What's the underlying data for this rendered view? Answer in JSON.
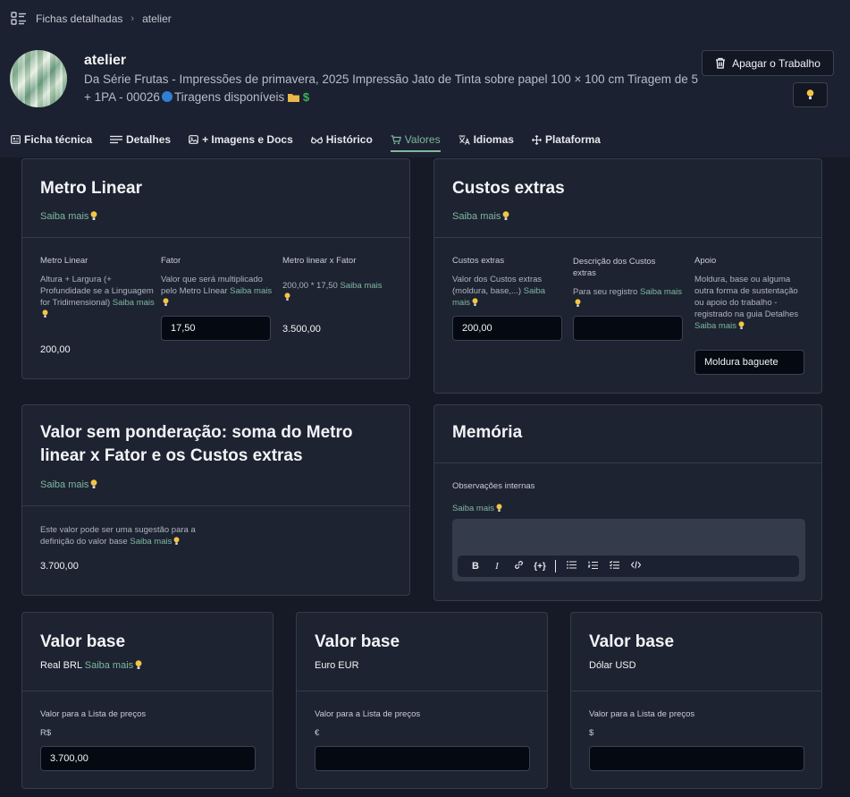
{
  "breadcrumb": {
    "items": [
      "Fichas detalhadas",
      "atelier"
    ]
  },
  "header": {
    "title": "atelier",
    "subtitle": "Da Série Frutas - Impressões de primavera, 2025 Impressão Jato de Tinta sobre papel 100 × 100 cm Tiragem de 5 + 1PA - 00026",
    "availability": "Tiragens disponíveis",
    "delete_label": "Apagar o Trabalho"
  },
  "tabs": [
    {
      "label": "Ficha técnica",
      "icon": "id-card-icon"
    },
    {
      "label": "Detalhes",
      "icon": "list-icon"
    },
    {
      "label": "+ Imagens e Docs",
      "icon": "image-icon"
    },
    {
      "label": "Histórico",
      "icon": "glasses-icon"
    },
    {
      "label": "Valores",
      "icon": "cart-icon",
      "active": true
    },
    {
      "label": "Idiomas",
      "icon": "globe-icon"
    },
    {
      "label": "Plataforma",
      "icon": "move-icon"
    }
  ],
  "saiba": "Saiba mais",
  "metro": {
    "title": "Metro Linear",
    "col1_label": "Metro Linear",
    "col1_desc": "Altura + Largura (+ Profundidade se a Linguagem for Tridimensional)",
    "col1_value": "200,00",
    "col2_label": "Fator",
    "col2_desc": "Valor que será multiplicado pelo Metro LInear",
    "col2_value": "17,50",
    "col3_label": "Metro linear x Fator",
    "col3_desc": "200,00 * 17,50",
    "col3_value": "3.500,00"
  },
  "custos": {
    "title": "Custos extras",
    "col1_label": "Custos extras",
    "col1_desc": "Valor dos Custos extras (moldura, base,...)",
    "col1_value": "200,00",
    "col2_label": "Descrição dos Custos extras",
    "col2_desc": "Para seu registro",
    "col2_value": "",
    "col3_label": "Apoio",
    "col3_desc": "Moldura, base ou alguma outra forma de sustentação ou apoio do trabalho - registrado na guia Detalhes",
    "col3_value": "Moldura baguete"
  },
  "sem_ponderacao": {
    "title": "Valor sem ponderação: soma do Metro linear x Fator e os Custos extras",
    "desc": "Este valor pode ser uma sugestão para a definição do valor base",
    "value": "3.700,00"
  },
  "memoria": {
    "title": "Memória",
    "label": "Observações internas",
    "toolbar": [
      "B",
      "I",
      "link",
      "{+}",
      "ul",
      "ol",
      "checklist",
      "code"
    ]
  },
  "valor_base": [
    {
      "title": "Valor base",
      "currency": "Real BRL",
      "label": "Valor para a Lista de preços",
      "symbol": "R$",
      "value": "3.700,00"
    },
    {
      "title": "Valor base",
      "currency": "Euro EUR",
      "label": "Valor para a Lista de preços",
      "symbol": "€",
      "value": ""
    },
    {
      "title": "Valor base",
      "currency": "Dólar USD",
      "label": "Valor para a Lista de preços",
      "symbol": "$",
      "value": ""
    }
  ],
  "colors": {
    "accent": "#7fb8a0",
    "background": "#151a26",
    "card": "#1d2331"
  }
}
